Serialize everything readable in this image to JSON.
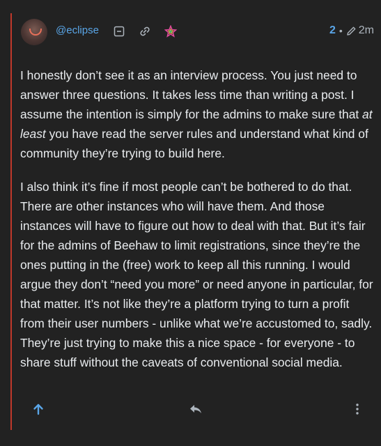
{
  "comment": {
    "username": "@eclipse",
    "score": "2",
    "separator": "•",
    "time": "2m",
    "paragraphs": [
      {
        "before": "I honestly don’t see it as an interview process. You just need to answer three questions. It takes less time than writing a post. I assume the intention is simply for the admins to make sure that ",
        "emphasis": "at least",
        "after": " you have read the server rules and understand what kind of community they’re trying to build here."
      },
      {
        "text": "I also think it’s fine if most people can’t be bothered to do that. There are other instances who will have them. And those instances will have to figure out how to deal with that. But it’s fair for the admins of Beehaw to limit registrations, since they’re the ones putting in the (free) work to keep all this running. I would argue they don’t “need you more” or need anyone in particular, for that matter. It’s not like they’re a platform trying to turn a profit from their user numbers - unlike what we’re accustomed to, sadly. They’re just trying to make this a nice space - for everyone - to share stuff without the caveats of conventional social media."
      }
    ]
  },
  "icons": {
    "avatar": "user-avatar",
    "collapse": "collapse-minus-icon",
    "link": "link-icon",
    "flair": "rainbow-star-flair-icon",
    "edited": "pencil-icon",
    "upvote": "arrow-up-icon",
    "reply": "reply-arrow-icon",
    "more": "more-vertical-icon"
  },
  "colors": {
    "background": "#222222",
    "accent": "#5aa6e8",
    "thread_border": "#c0392b",
    "text": "#e9ecef",
    "muted": "#adb5bd"
  }
}
